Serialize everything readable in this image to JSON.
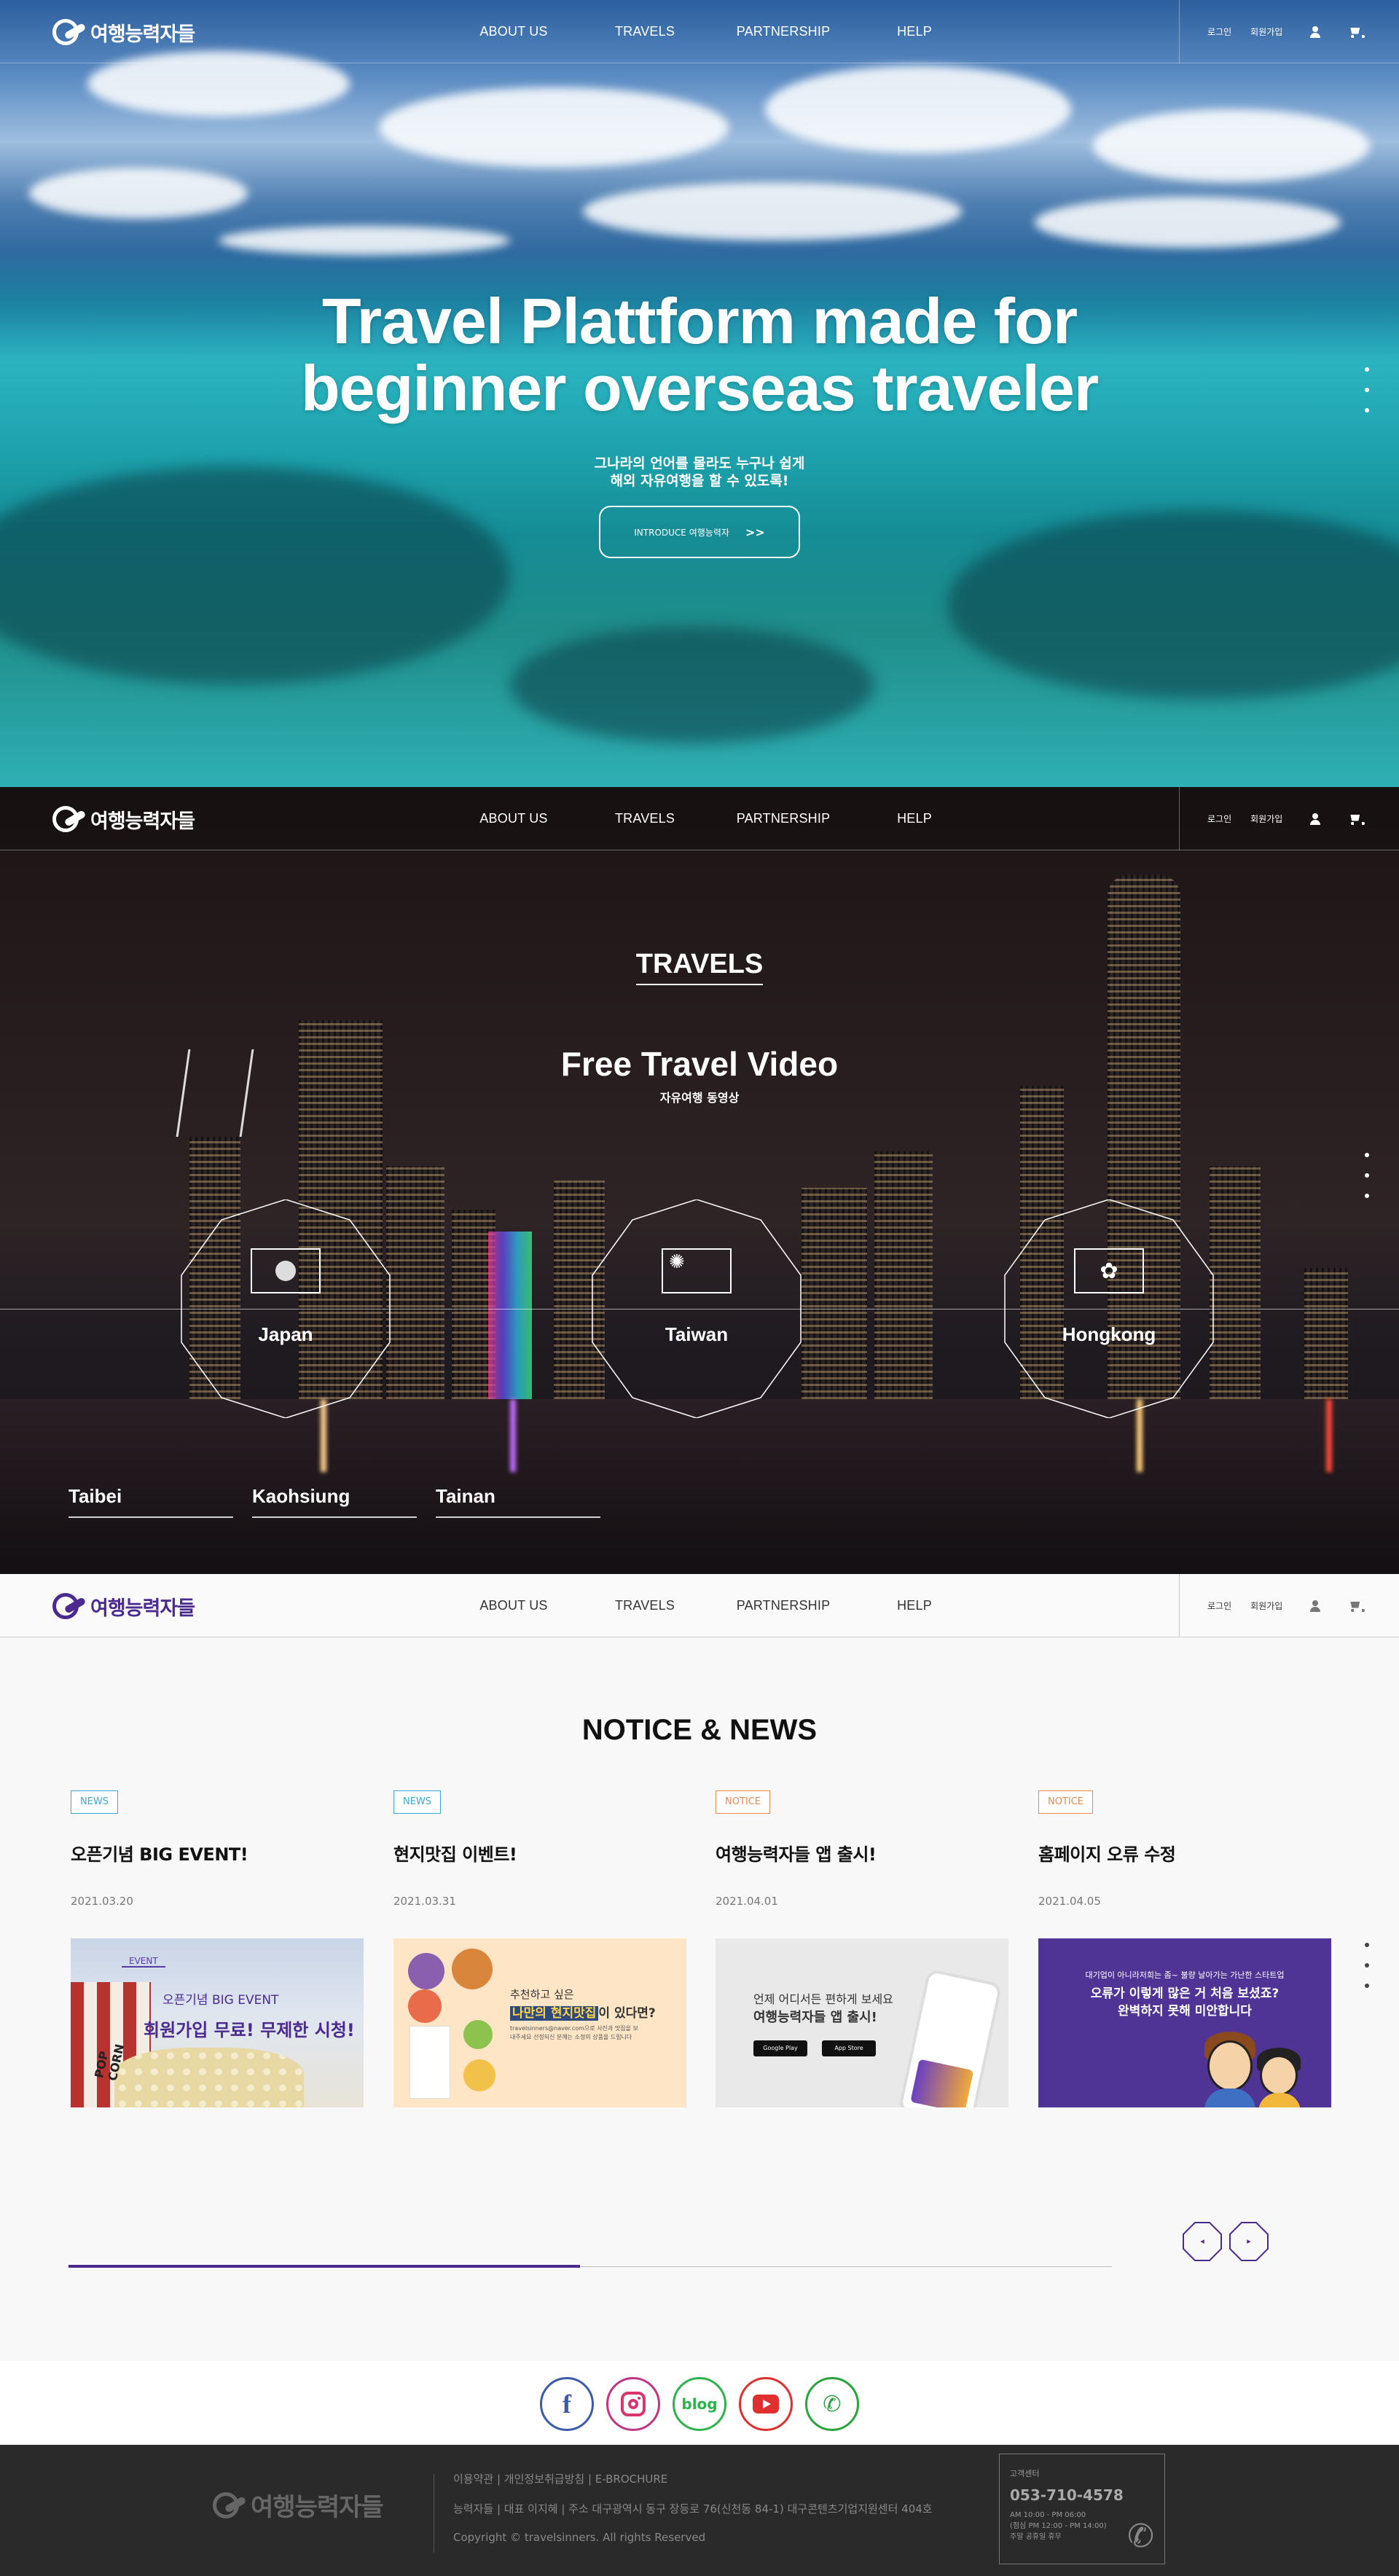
{
  "brand": {
    "name": "여행능력자들"
  },
  "nav": {
    "items": [
      "ABOUT US",
      "TRAVELS",
      "PARTNERSHIP",
      "HELP"
    ],
    "login": "로그인",
    "signup": "회원가입"
  },
  "hero": {
    "title_line1": "Travel Plattform made for",
    "title_line2": "beginner overseas traveler",
    "sub_line1": "그나라의 언어를 몰라도 누구나 쉽게",
    "sub_line2": "해외 자유여행을 할 수 있도록!",
    "button_label": "INTRODUCE 여행능력자",
    "button_icon": "double-chevron-right"
  },
  "travels": {
    "section_title": "TRAVELS",
    "video_title": "Free Travel Video",
    "video_sub": "자유여행 동영상",
    "countries": [
      {
        "name": "Japan",
        "flag_icon": "japan-flag-icon"
      },
      {
        "name": "Taiwan",
        "flag_icon": "taiwan-flag-icon"
      },
      {
        "name": "Hongkong",
        "flag_icon": "hongkong-flag-icon"
      }
    ],
    "cities": [
      "Taibei",
      "Kaohsiung",
      "Tainan"
    ]
  },
  "notice": {
    "section_title": "NOTICE & NEWS",
    "cards": [
      {
        "badge": "NEWS",
        "title": "오픈기념 BIG EVENT!",
        "date": "2021.03.20",
        "thumb": {
          "event": "EVENT",
          "line1": "오픈기념 BIG EVENT",
          "line2": "회원가입 무료! 무제한 시청!",
          "pop": "POP CORN"
        }
      },
      {
        "badge": "NEWS",
        "title": "현지맛집 이벤트!",
        "date": "2021.03.31",
        "thumb": {
          "line1": "추천하고 싶은",
          "line2a": "나만의 현지맛집",
          "line2b": "이 있다면?",
          "line3": "travelsinners@naver.com으로 사진과 맛집을 보내주세요 선정되신 분께는 소정의 상품을 드립니다"
        }
      },
      {
        "badge": "NOTICE",
        "title": "여행능력자들 앱 출시!",
        "date": "2021.04.01",
        "thumb": {
          "line1": "언제 어디서든 편하게 보세요",
          "line2": "여행능력자들 앱 출시!",
          "store1": "Google Play",
          "store2": "App Store"
        }
      },
      {
        "badge": "NOTICE",
        "title": "홈페이지 오류 수정",
        "date": "2021.04.05",
        "thumb": {
          "line1": "대기업이 아니라저희는 좀~ 불량 날아가는 가난한 스타트업",
          "line2": "오류가 이렇게 많은 거 처음 보셨죠?",
          "line3": "완벽하지 못해 미안합니다"
        }
      }
    ],
    "prev_label": "◂",
    "next_label": "▸",
    "slider_progress": 0.49
  },
  "social": {
    "facebook": "f",
    "blog": "blog",
    "whatsapp": "✆"
  },
  "footer": {
    "links": "이용약관  |  개인정보취급방침  |  E-BROCHURE",
    "address": "능력자들  |  대표 이지혜  |  주소 대구광역시 동구 장등로 76(신천동 84-1) 대구콘텐츠기업지원센터 404호",
    "copyright": "Copyright © travelsinners. All rights Reserved",
    "cs_label": "고객센터",
    "cs_tel": "053-710-4578",
    "cs_hours1": "AM 10:00 - PM 06:00",
    "cs_hours2": "(점심 PM 12:00 - PM 14:00)",
    "cs_hours3": "주말 공휴일 휴무"
  },
  "colors": {
    "accent": "#4b2a8f",
    "news": "#3ca7d8",
    "notice": "#e98a53",
    "footer_bg": "#2a2a2a"
  }
}
